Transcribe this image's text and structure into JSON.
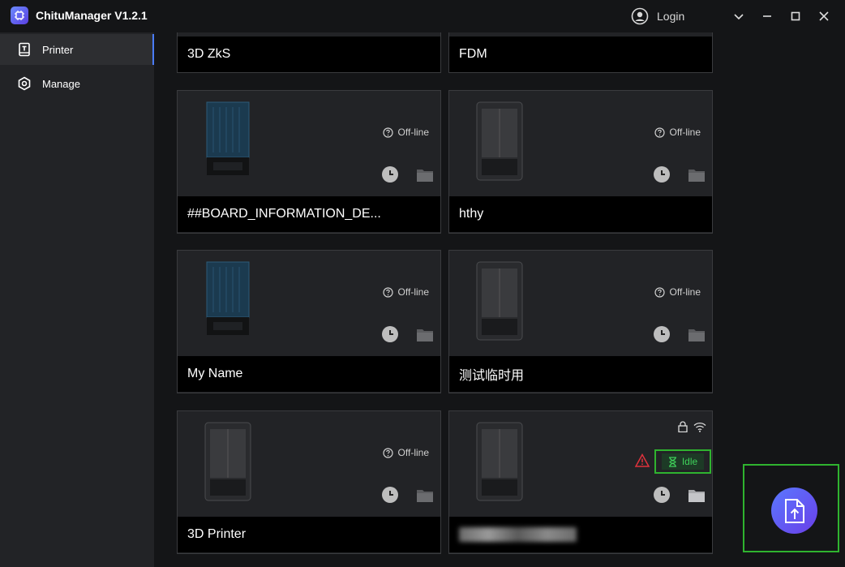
{
  "app": {
    "title": "ChituManager V1.2.1"
  },
  "titlebar": {
    "login_label": "Login"
  },
  "sidebar": {
    "items": [
      {
        "label": "Printer",
        "icon": "printer-icon",
        "active": true
      },
      {
        "label": "Manage",
        "icon": "gear-hex-icon",
        "active": false
      }
    ]
  },
  "cards": [
    {
      "name": "3D ZkS"
    },
    {
      "name": "FDM"
    },
    {
      "name": "##BOARD_INFORMATION_DE...",
      "status": "Off-line",
      "thumb": "blue-printer"
    },
    {
      "name": "hthy",
      "status": "Off-line",
      "thumb": "gray-printer"
    },
    {
      "name": "My Name",
      "status": "Off-line",
      "thumb": "blue-printer"
    },
    {
      "name": "测试临时用",
      "status": "Off-line",
      "thumb": "gray-printer"
    },
    {
      "name": "3D Printer",
      "status": "Off-line",
      "thumb": "gray-printer"
    },
    {
      "name": "",
      "status": "Idle",
      "thumb": "gray-printer"
    }
  ],
  "colors": {
    "accent": "#4a7cff",
    "idle_green": "#3fd15a",
    "highlight_green": "#2fb32f",
    "warning_red": "#e0323c"
  }
}
